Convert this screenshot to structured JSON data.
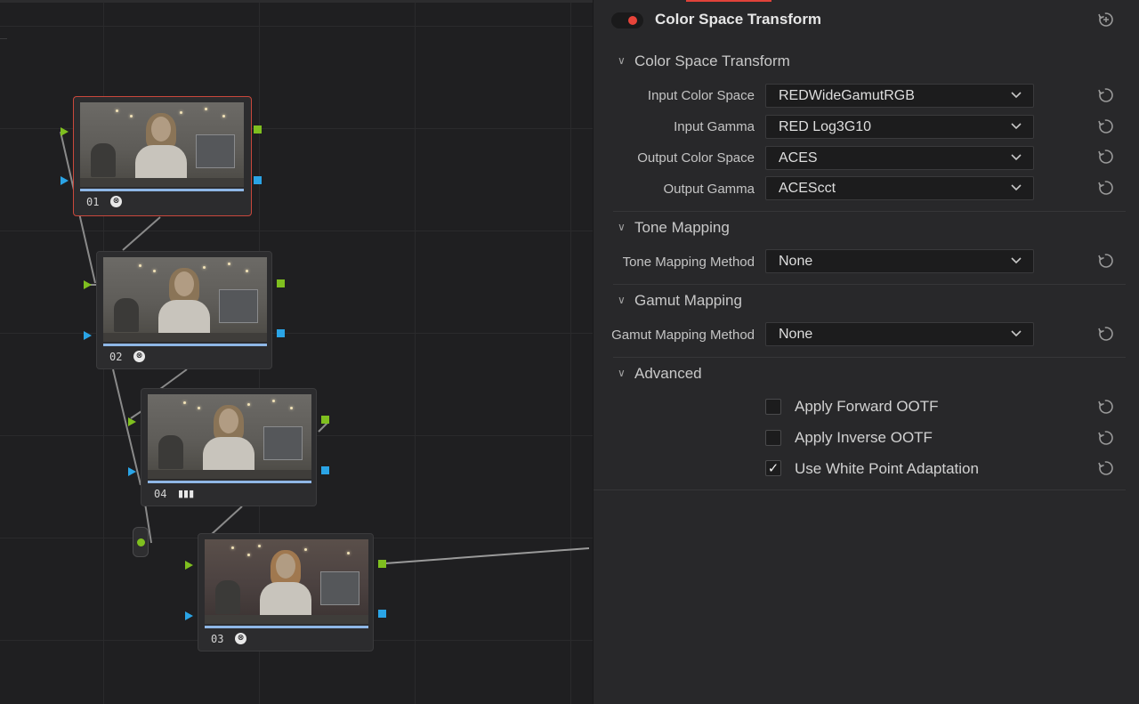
{
  "nodes": [
    {
      "label": "01",
      "icon": "aces-icon",
      "selected": true
    },
    {
      "label": "02",
      "icon": "aces-icon",
      "selected": false
    },
    {
      "label": "04",
      "icon": "bars-icon",
      "selected": false
    },
    {
      "label": "03",
      "icon": "aces-icon",
      "selected": false
    }
  ],
  "inspector": {
    "title": "Color Space Transform",
    "sections": {
      "cst": "Color Space Transform",
      "tone": "Tone Mapping",
      "gamut": "Gamut Mapping",
      "advanced": "Advanced"
    },
    "rows": {
      "input_color_space": {
        "label": "Input Color Space",
        "value": "REDWideGamutRGB"
      },
      "input_gamma": {
        "label": "Input Gamma",
        "value": "RED Log3G10"
      },
      "output_color_space": {
        "label": "Output Color Space",
        "value": "ACES"
      },
      "output_gamma": {
        "label": "Output Gamma",
        "value": "ACEScct"
      },
      "tone_mapping_method": {
        "label": "Tone Mapping Method",
        "value": "None"
      },
      "gamut_mapping_method": {
        "label": "Gamut Mapping Method",
        "value": "None"
      }
    },
    "checks": {
      "forward_ootf": {
        "label": "Apply Forward OOTF",
        "checked": false
      },
      "inverse_ootf": {
        "label": "Apply Inverse OOTF",
        "checked": false
      },
      "white_point": {
        "label": "Use White Point Adaptation",
        "checked": true
      }
    },
    "checkmark": "✓"
  },
  "colors": {
    "accent_red": "#e0423a",
    "node_output_green": "#7fbf1f",
    "node_output_blue": "#2aa4e6",
    "progress_blue": "#8fb7e6"
  }
}
